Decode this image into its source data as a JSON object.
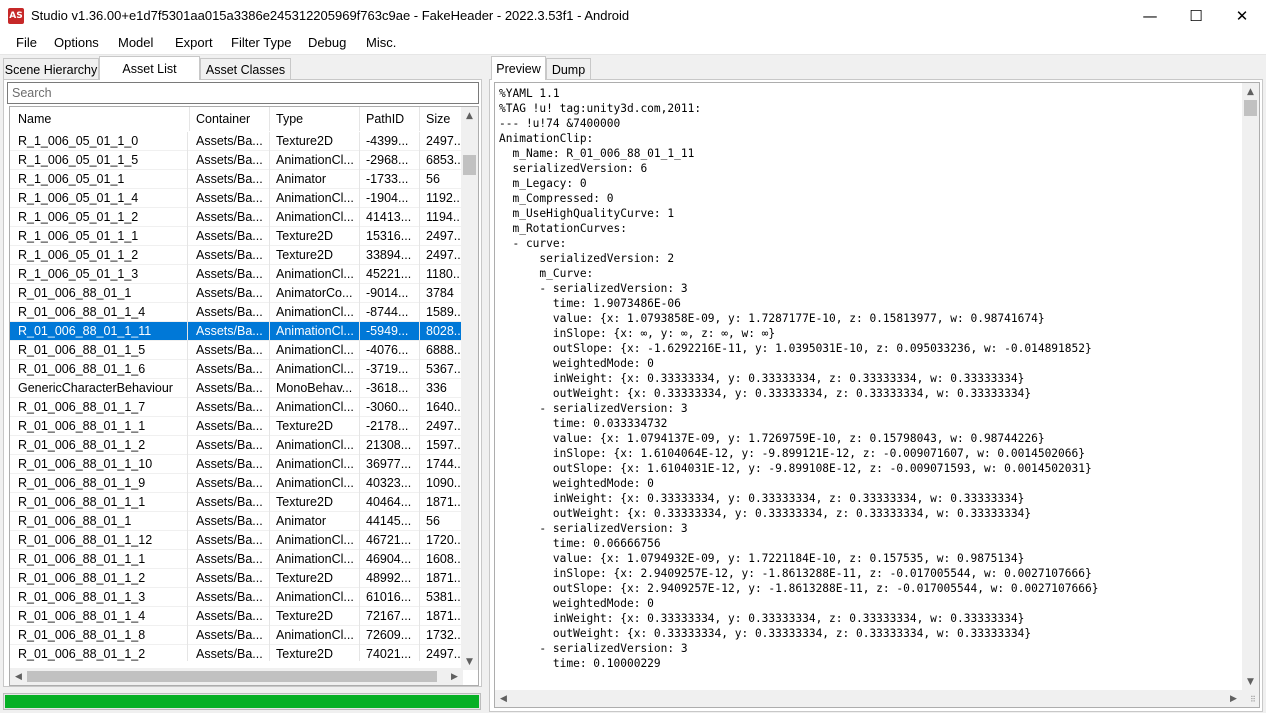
{
  "window": {
    "app_icon_text": "AS",
    "title": "Studio v1.36.00+e1d7f5301aa015a3386e245312205969f763c9ae - FakeHeader - 2022.3.53f1 - Android",
    "minimize_glyph": "—",
    "maximize_glyph": "☐",
    "close_glyph": "✕"
  },
  "menu": [
    "File",
    "Options",
    "Model",
    "Export",
    "Filter Type",
    "Debug",
    "Misc."
  ],
  "left_tabs": [
    "Scene Hierarchy",
    "Asset List",
    "Asset Classes"
  ],
  "active_left_tab": "Asset List",
  "search": {
    "placeholder": "Search"
  },
  "asset_list": {
    "columns": [
      "Name",
      "Container",
      "Type",
      "PathID",
      "Size"
    ],
    "sort_indicator": "^",
    "rows": [
      {
        "name": "R_1_006_05_01_1_0",
        "container": "Assets/Ba...",
        "type": "Texture2D",
        "path_id": "-4399...",
        "size": "2497..."
      },
      {
        "name": "R_1_006_05_01_1_5",
        "container": "Assets/Ba...",
        "type": "AnimationCl...",
        "path_id": "-2968...",
        "size": "6853..."
      },
      {
        "name": "R_1_006_05_01_1",
        "container": "Assets/Ba...",
        "type": "Animator",
        "path_id": "-1733...",
        "size": "56"
      },
      {
        "name": "R_1_006_05_01_1_4",
        "container": "Assets/Ba...",
        "type": "AnimationCl...",
        "path_id": "-1904...",
        "size": "1192..."
      },
      {
        "name": "R_1_006_05_01_1_2",
        "container": "Assets/Ba...",
        "type": "AnimationCl...",
        "path_id": "41413...",
        "size": "1194..."
      },
      {
        "name": "R_1_006_05_01_1_1",
        "container": "Assets/Ba...",
        "type": "Texture2D",
        "path_id": "15316...",
        "size": "2497..."
      },
      {
        "name": "R_1_006_05_01_1_2",
        "container": "Assets/Ba...",
        "type": "Texture2D",
        "path_id": "33894...",
        "size": "2497..."
      },
      {
        "name": "R_1_006_05_01_1_3",
        "container": "Assets/Ba...",
        "type": "AnimationCl...",
        "path_id": "45221...",
        "size": "1180..."
      },
      {
        "name": "R_01_006_88_01_1",
        "container": "Assets/Ba...",
        "type": "AnimatorCo...",
        "path_id": "-9014...",
        "size": "3784"
      },
      {
        "name": "R_01_006_88_01_1_4",
        "container": "Assets/Ba...",
        "type": "AnimationCl...",
        "path_id": "-8744...",
        "size": "1589..."
      },
      {
        "name": "R_01_006_88_01_1_11",
        "container": "Assets/Ba...",
        "type": "AnimationCl...",
        "path_id": "-5949...",
        "size": "8028...",
        "selected": true
      },
      {
        "name": "R_01_006_88_01_1_5",
        "container": "Assets/Ba...",
        "type": "AnimationCl...",
        "path_id": "-4076...",
        "size": "6888..."
      },
      {
        "name": "R_01_006_88_01_1_6",
        "container": "Assets/Ba...",
        "type": "AnimationCl...",
        "path_id": "-3719...",
        "size": "5367..."
      },
      {
        "name": "GenericCharacterBehaviour",
        "container": "Assets/Ba...",
        "type": "MonoBehav...",
        "path_id": "-3618...",
        "size": "336"
      },
      {
        "name": "R_01_006_88_01_1_7",
        "container": "Assets/Ba...",
        "type": "AnimationCl...",
        "path_id": "-3060...",
        "size": "1640..."
      },
      {
        "name": "R_01_006_88_01_1_1",
        "container": "Assets/Ba...",
        "type": "Texture2D",
        "path_id": "-2178...",
        "size": "2497..."
      },
      {
        "name": "R_01_006_88_01_1_2",
        "container": "Assets/Ba...",
        "type": "AnimationCl...",
        "path_id": "21308...",
        "size": "1597..."
      },
      {
        "name": "R_01_006_88_01_1_10",
        "container": "Assets/Ba...",
        "type": "AnimationCl...",
        "path_id": "36977...",
        "size": "1744..."
      },
      {
        "name": "R_01_006_88_01_1_9",
        "container": "Assets/Ba...",
        "type": "AnimationCl...",
        "path_id": "40323...",
        "size": "1090..."
      },
      {
        "name": "R_01_006_88_01_1_1",
        "container": "Assets/Ba...",
        "type": "Texture2D",
        "path_id": "40464...",
        "size": "1871..."
      },
      {
        "name": "R_01_006_88_01_1",
        "container": "Assets/Ba...",
        "type": "Animator",
        "path_id": "44145...",
        "size": "56"
      },
      {
        "name": "R_01_006_88_01_1_12",
        "container": "Assets/Ba...",
        "type": "AnimationCl...",
        "path_id": "46721...",
        "size": "1720..."
      },
      {
        "name": "R_01_006_88_01_1_1",
        "container": "Assets/Ba...",
        "type": "AnimationCl...",
        "path_id": "46904...",
        "size": "1608..."
      },
      {
        "name": "R_01_006_88_01_1_2",
        "container": "Assets/Ba...",
        "type": "Texture2D",
        "path_id": "48992...",
        "size": "1871..."
      },
      {
        "name": "R_01_006_88_01_1_3",
        "container": "Assets/Ba...",
        "type": "AnimationCl...",
        "path_id": "61016...",
        "size": "5381..."
      },
      {
        "name": "R_01_006_88_01_1_4",
        "container": "Assets/Ba...",
        "type": "Texture2D",
        "path_id": "72167...",
        "size": "1871..."
      },
      {
        "name": "R_01_006_88_01_1_8",
        "container": "Assets/Ba...",
        "type": "AnimationCl...",
        "path_id": "72609...",
        "size": "1732..."
      },
      {
        "name": "R_01_006_88_01_1_2",
        "container": "Assets/Ba...",
        "type": "Texture2D",
        "path_id": "74021...",
        "size": "2497..."
      }
    ]
  },
  "progress": {
    "fraction": 1.0,
    "color": "#06b025"
  },
  "right_tabs": [
    "Preview",
    "Dump"
  ],
  "active_right_tab": "Preview",
  "preview_lines": [
    "%YAML 1.1",
    "%TAG !u! tag:unity3d.com,2011:",
    "--- !u!74 &7400000",
    "AnimationClip:",
    "  m_Name: R_01_006_88_01_1_11",
    "  serializedVersion: 6",
    "  m_Legacy: 0",
    "  m_Compressed: 0",
    "  m_UseHighQualityCurve: 1",
    "  m_RotationCurves:",
    "  - curve:",
    "      serializedVersion: 2",
    "      m_Curve:",
    "      - serializedVersion: 3",
    "        time: 1.9073486E-06",
    "        value: {x: 1.0793858E-09, y: 1.7287177E-10, z: 0.15813977, w: 0.98741674}",
    "        inSlope: {x: ∞, y: ∞, z: ∞, w: ∞}",
    "        outSlope: {x: -1.6292216E-11, y: 1.0395031E-10, z: 0.095033236, w: -0.014891852}",
    "        weightedMode: 0",
    "        inWeight: {x: 0.33333334, y: 0.33333334, z: 0.33333334, w: 0.33333334}",
    "        outWeight: {x: 0.33333334, y: 0.33333334, z: 0.33333334, w: 0.33333334}",
    "      - serializedVersion: 3",
    "        time: 0.033334732",
    "        value: {x: 1.0794137E-09, y: 1.7269759E-10, z: 0.15798043, w: 0.98744226}",
    "        inSlope: {x: 1.6104064E-12, y: -9.899121E-12, z: -0.009071607, w: 0.0014502066}",
    "        outSlope: {x: 1.6104031E-12, y: -9.899108E-12, z: -0.009071593, w: 0.0014502031}",
    "        weightedMode: 0",
    "        inWeight: {x: 0.33333334, y: 0.33333334, z: 0.33333334, w: 0.33333334}",
    "        outWeight: {x: 0.33333334, y: 0.33333334, z: 0.33333334, w: 0.33333334}",
    "      - serializedVersion: 3",
    "        time: 0.06666756",
    "        value: {x: 1.0794932E-09, y: 1.7221184E-10, z: 0.157535, w: 0.9875134}",
    "        inSlope: {x: 2.9409257E-12, y: -1.8613288E-11, z: -0.017005544, w: 0.0027107666}",
    "        outSlope: {x: 2.9409257E-12, y: -1.8613288E-11, z: -0.017005544, w: 0.0027107666}",
    "        weightedMode: 0",
    "        inWeight: {x: 0.33333334, y: 0.33333334, z: 0.33333334, w: 0.33333334}",
    "        outWeight: {x: 0.33333334, y: 0.33333334, z: 0.33333334, w: 0.33333334}",
    "      - serializedVersion: 3",
    "        time: 0.10000229"
  ],
  "scroll_glyphs": {
    "up": "▲",
    "down": "▼",
    "left": "◀",
    "right": "▶"
  }
}
